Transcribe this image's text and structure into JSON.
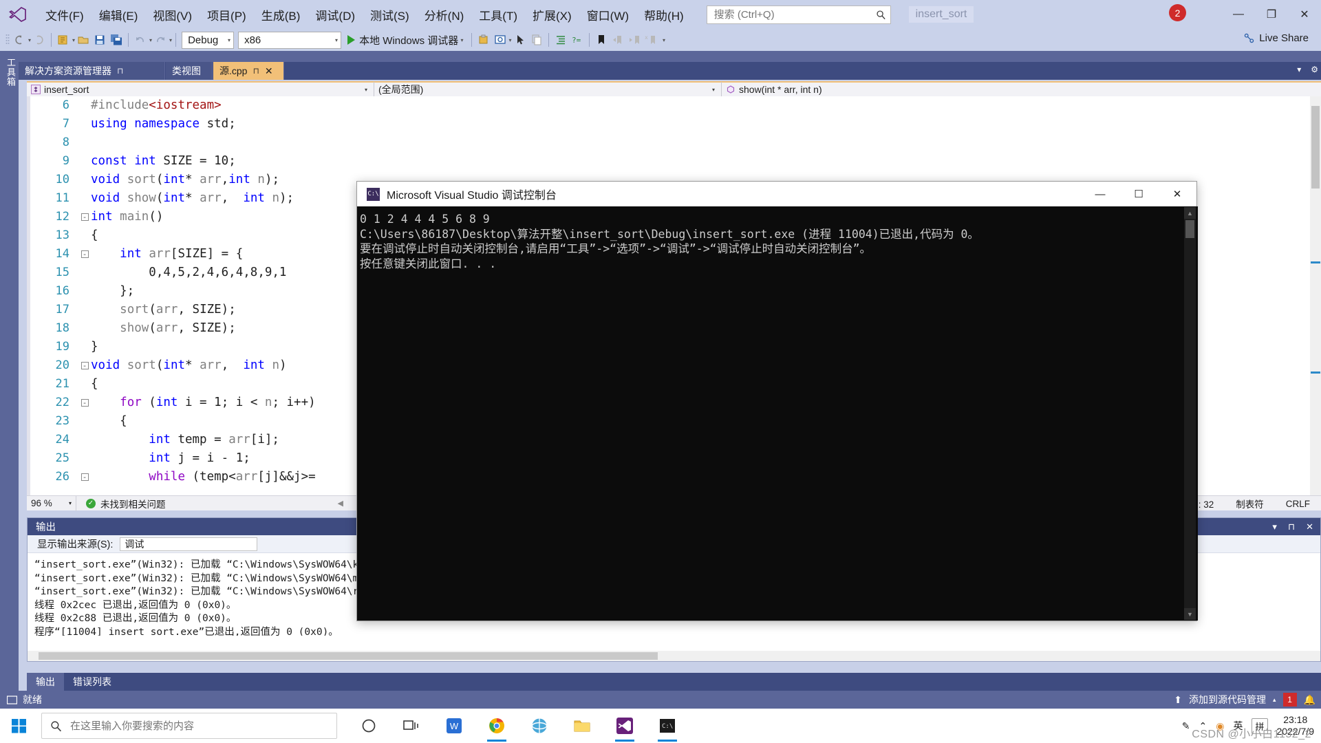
{
  "menubar": {
    "logo_icon": "visual-studio-logo",
    "items": [
      "文件(F)",
      "编辑(E)",
      "视图(V)",
      "项目(P)",
      "生成(B)",
      "调试(D)",
      "测试(S)",
      "分析(N)",
      "工具(T)",
      "扩展(X)",
      "窗口(W)",
      "帮助(H)"
    ],
    "search_placeholder": "搜索 (Ctrl+Q)",
    "search_value": "",
    "project_title": "insert_sort",
    "notification_count": "2",
    "window_buttons": {
      "minimize": "—",
      "maximize": "❐",
      "close": "✕"
    }
  },
  "toolbar": {
    "config": "Debug",
    "platform": "x86",
    "run_label": "本地 Windows 调试器",
    "live_share": "Live Share"
  },
  "left_rail": {
    "label": "工具箱"
  },
  "doc_tabs": [
    {
      "label": "解决方案资源管理器",
      "pinned": true,
      "active": false
    },
    {
      "label": "类视图",
      "pinned": false,
      "active": false
    },
    {
      "label": "源.cpp",
      "pinned": true,
      "active": true,
      "close": "✕"
    }
  ],
  "navbar": {
    "scope_icon": "class-icon",
    "project": "insert_sort",
    "namespace": "(全局范围)",
    "member_icon": "method-icon",
    "member": "show(int * arr, int n)"
  },
  "editor": {
    "lines": [
      {
        "num": "6",
        "fold": "",
        "tokens": [
          {
            "t": "#include",
            "c": "pp"
          },
          {
            "t": "<iostream>",
            "c": "str"
          }
        ]
      },
      {
        "num": "7",
        "fold": "",
        "tokens": [
          {
            "t": "using",
            "c": "k"
          },
          {
            "t": " ",
            "c": "plain"
          },
          {
            "t": "namespace",
            "c": "k"
          },
          {
            "t": " std;",
            "c": "plain"
          }
        ]
      },
      {
        "num": "8",
        "fold": "",
        "tokens": []
      },
      {
        "num": "9",
        "fold": "",
        "tokens": [
          {
            "t": "const",
            "c": "k"
          },
          {
            "t": " ",
            "c": "plain"
          },
          {
            "t": "int",
            "c": "k"
          },
          {
            "t": " SIZE = ",
            "c": "plain"
          },
          {
            "t": "10",
            "c": "plain"
          },
          {
            "t": ";",
            "c": "plain"
          }
        ]
      },
      {
        "num": "10",
        "fold": "",
        "tokens": [
          {
            "t": "void",
            "c": "k"
          },
          {
            "t": " ",
            "c": "plain"
          },
          {
            "t": "sort",
            "c": "var"
          },
          {
            "t": "(",
            "c": "plain"
          },
          {
            "t": "int",
            "c": "k"
          },
          {
            "t": "* ",
            "c": "plain"
          },
          {
            "t": "arr",
            "c": "var"
          },
          {
            "t": ",",
            "c": "plain"
          },
          {
            "t": "int",
            "c": "k"
          },
          {
            "t": " ",
            "c": "plain"
          },
          {
            "t": "n",
            "c": "var"
          },
          {
            "t": ");",
            "c": "plain"
          }
        ]
      },
      {
        "num": "11",
        "fold": "",
        "tokens": [
          {
            "t": "void",
            "c": "k"
          },
          {
            "t": " ",
            "c": "plain"
          },
          {
            "t": "show",
            "c": "var"
          },
          {
            "t": "(",
            "c": "plain"
          },
          {
            "t": "int",
            "c": "k"
          },
          {
            "t": "* ",
            "c": "plain"
          },
          {
            "t": "arr",
            "c": "var"
          },
          {
            "t": ",  ",
            "c": "plain"
          },
          {
            "t": "int",
            "c": "k"
          },
          {
            "t": " ",
            "c": "plain"
          },
          {
            "t": "n",
            "c": "var"
          },
          {
            "t": ");",
            "c": "plain"
          }
        ]
      },
      {
        "num": "12",
        "fold": "-",
        "tokens": [
          {
            "t": "int",
            "c": "k"
          },
          {
            "t": " ",
            "c": "plain"
          },
          {
            "t": "main",
            "c": "var"
          },
          {
            "t": "()",
            "c": "plain"
          }
        ]
      },
      {
        "num": "13",
        "fold": "",
        "tokens": [
          {
            "t": "{",
            "c": "plain"
          }
        ]
      },
      {
        "num": "14",
        "fold": "-",
        "tokens": [
          {
            "t": "    ",
            "c": "plain"
          },
          {
            "t": "int",
            "c": "k"
          },
          {
            "t": " ",
            "c": "plain"
          },
          {
            "t": "arr",
            "c": "var"
          },
          {
            "t": "[SIZE] = {",
            "c": "plain"
          }
        ]
      },
      {
        "num": "15",
        "fold": "",
        "tokens": [
          {
            "t": "        0,4,5,2,4,6,4,8,9,1",
            "c": "plain"
          }
        ]
      },
      {
        "num": "16",
        "fold": "",
        "tokens": [
          {
            "t": "    };",
            "c": "plain"
          }
        ]
      },
      {
        "num": "17",
        "fold": "",
        "tokens": [
          {
            "t": "    ",
            "c": "plain"
          },
          {
            "t": "sort",
            "c": "var"
          },
          {
            "t": "(",
            "c": "plain"
          },
          {
            "t": "arr",
            "c": "var"
          },
          {
            "t": ", SIZE);",
            "c": "plain"
          }
        ]
      },
      {
        "num": "18",
        "fold": "",
        "tokens": [
          {
            "t": "    ",
            "c": "plain"
          },
          {
            "t": "show",
            "c": "var"
          },
          {
            "t": "(",
            "c": "plain"
          },
          {
            "t": "arr",
            "c": "var"
          },
          {
            "t": ", SIZE);",
            "c": "plain"
          }
        ]
      },
      {
        "num": "19",
        "fold": "",
        "tokens": [
          {
            "t": "}",
            "c": "plain"
          }
        ]
      },
      {
        "num": "20",
        "fold": "-",
        "tokens": [
          {
            "t": "void",
            "c": "k"
          },
          {
            "t": " ",
            "c": "plain"
          },
          {
            "t": "sort",
            "c": "var"
          },
          {
            "t": "(",
            "c": "plain"
          },
          {
            "t": "int",
            "c": "k"
          },
          {
            "t": "* ",
            "c": "plain"
          },
          {
            "t": "arr",
            "c": "var"
          },
          {
            "t": ",  ",
            "c": "plain"
          },
          {
            "t": "int",
            "c": "k"
          },
          {
            "t": " ",
            "c": "plain"
          },
          {
            "t": "n",
            "c": "var"
          },
          {
            "t": ")",
            "c": "plain"
          }
        ]
      },
      {
        "num": "21",
        "fold": "",
        "tokens": [
          {
            "t": "{",
            "c": "plain"
          }
        ]
      },
      {
        "num": "22",
        "fold": "-",
        "tokens": [
          {
            "t": "    ",
            "c": "plain"
          },
          {
            "t": "for",
            "c": "kp"
          },
          {
            "t": " (",
            "c": "plain"
          },
          {
            "t": "int",
            "c": "k"
          },
          {
            "t": " i = ",
            "c": "plain"
          },
          {
            "t": "1",
            "c": "plain"
          },
          {
            "t": "; i < ",
            "c": "plain"
          },
          {
            "t": "n",
            "c": "var"
          },
          {
            "t": "; i++)",
            "c": "plain"
          }
        ]
      },
      {
        "num": "23",
        "fold": "",
        "tokens": [
          {
            "t": "    {",
            "c": "plain"
          }
        ]
      },
      {
        "num": "24",
        "fold": "",
        "tokens": [
          {
            "t": "        ",
            "c": "plain"
          },
          {
            "t": "int",
            "c": "k"
          },
          {
            "t": " temp = ",
            "c": "plain"
          },
          {
            "t": "arr",
            "c": "var"
          },
          {
            "t": "[i];",
            "c": "plain"
          }
        ]
      },
      {
        "num": "25",
        "fold": "",
        "tokens": [
          {
            "t": "        ",
            "c": "plain"
          },
          {
            "t": "int",
            "c": "k"
          },
          {
            "t": " j = i - ",
            "c": "plain"
          },
          {
            "t": "1",
            "c": "plain"
          },
          {
            "t": ";",
            "c": "plain"
          }
        ]
      },
      {
        "num": "26",
        "fold": "-",
        "tokens": [
          {
            "t": "        ",
            "c": "plain"
          },
          {
            "t": "while",
            "c": "kp"
          },
          {
            "t": " (temp<",
            "c": "plain"
          },
          {
            "t": "arr",
            "c": "var"
          },
          {
            "t": "[j]&&j>=",
            "c": "plain"
          }
        ]
      }
    ]
  },
  "editor_status": {
    "zoom": "96 %",
    "issues": "未找到相关问题",
    "col": "列: 32",
    "tabs_mode": "制表符",
    "line_ending": "CRLF"
  },
  "output_panel": {
    "title": "输出",
    "source_label": "显示输出来源(S):",
    "source_value": "调试",
    "lines": [
      "“insert_sort.exe”(Win32): 已加载 “C:\\Windows\\SysWOW64\\ke",
      "“insert_sort.exe”(Win32): 已加载 “C:\\Windows\\SysWOW64\\ms",
      "“insert_sort.exe”(Win32): 已加载 “C:\\Windows\\SysWOW64\\rp",
      "线程 0x2cec 已退出,返回值为 0 (0x0)。",
      "线程 0x2c88 已退出,返回值为 0 (0x0)。",
      "程序“[11004] insert_sort.exe”已退出,返回值为 0 (0x0)。"
    ]
  },
  "bottom_tabs": [
    {
      "label": "输出",
      "active": true
    },
    {
      "label": "错误列表",
      "active": false
    }
  ],
  "statusbar": {
    "ready": "就绪",
    "source_control": "添加到源代码管理",
    "badge": "1"
  },
  "console_window": {
    "icon": "console-icon",
    "title": "Microsoft Visual Studio 调试控制台",
    "buttons": {
      "minimize": "—",
      "maximize": "☐",
      "close": "✕"
    },
    "lines": [
      "0 1 2 4 4 4 5 6 8 9",
      "C:\\Users\\86187\\Desktop\\算法开整\\insert_sort\\Debug\\insert_sort.exe (进程 11004)已退出,代码为 0。",
      "要在调试停止时自动关闭控制台,请启用“工具”->“选项”->“调试”->“调试停止时自动关闭控制台”。",
      "按任意键关闭此窗口. . ."
    ]
  },
  "taskbar": {
    "start_icon": "windows-start-icon",
    "search_placeholder": "在这里输入你要搜索的内容",
    "search_value": "",
    "icons": [
      {
        "name": "cortana-icon"
      },
      {
        "name": "task-view-icon"
      },
      {
        "name": "wps-icon"
      },
      {
        "name": "chrome-icon"
      },
      {
        "name": "ie-icon"
      },
      {
        "name": "file-explorer-icon"
      },
      {
        "name": "visual-studio-icon"
      },
      {
        "name": "console-window-icon"
      }
    ],
    "tray": {
      "pen": "✎",
      "chevron": "⌃",
      "shield": "◉",
      "ime_lang": "英",
      "ime_mode": "拼",
      "time": "23:18",
      "date": "2022/7/9"
    }
  },
  "watermark": "CSDN @小小白1152_2"
}
